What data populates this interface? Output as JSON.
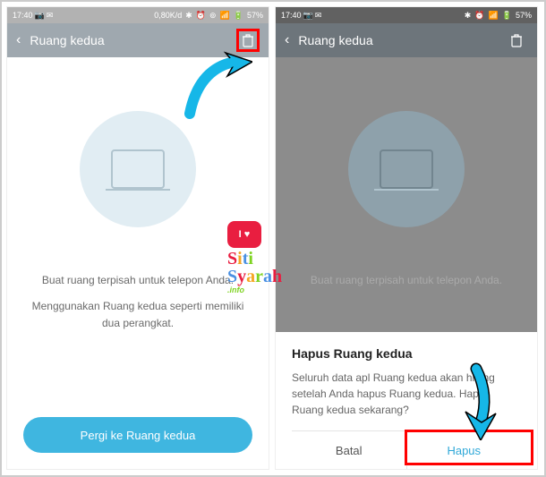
{
  "status": {
    "time": "17:40",
    "net": "0,80K/d",
    "battery": "57%"
  },
  "header": {
    "title": "Ruang kedua"
  },
  "screen1": {
    "desc1": "Buat ruang terpisah untuk telepon Anda.",
    "desc2": "Menggunakan Ruang kedua seperti memiliki dua perangkat.",
    "cta": "Pergi ke Ruang kedua"
  },
  "screen2": {
    "desc1": "Buat ruang terpisah untuk telepon Anda."
  },
  "dialog": {
    "title": "Hapus Ruang kedua",
    "text": "Seluruh data apl Ruang kedua akan hilang setelah Anda hapus Ruang kedua. Hapus Ruang kedua sekarang?",
    "cancel": "Batal",
    "confirm": "Hapus"
  },
  "watermark": {
    "bubble": "I ♥",
    "line1": "Siti",
    "line2": "Syarah",
    "info": ".info"
  }
}
